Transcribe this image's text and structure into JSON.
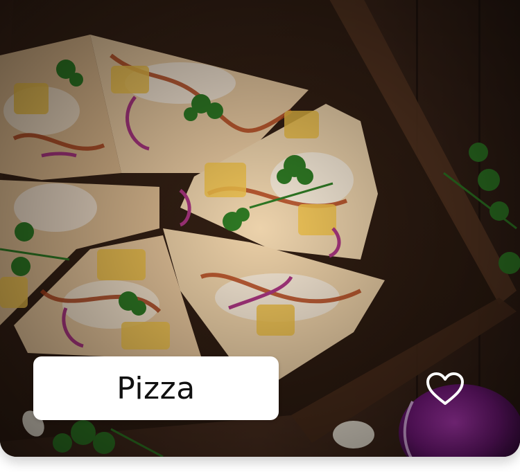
{
  "card": {
    "title": "Pizza",
    "favorite": false
  },
  "icons": {
    "favorite": "heart-outline-icon"
  },
  "colors": {
    "pill_background": "#ffffff",
    "title_text": "#111111",
    "heart_stroke": "#ffffff"
  }
}
